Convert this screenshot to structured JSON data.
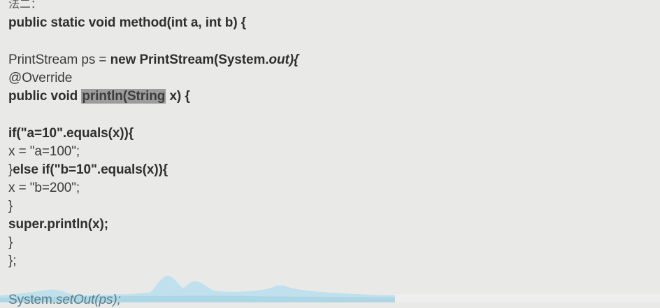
{
  "heading": "法二：",
  "lines": {
    "l1": "public static void method(int a, int b) {",
    "l2a": "PrintStream ps = ",
    "l2b": "new PrintStream(System.",
    "l2c": "out)",
    "l2d": "{",
    "l3": "@Override",
    "l4a": "public void ",
    "l4b": "println(String",
    "l4c": " x) {",
    "l5a": "if(\"a=10\".equals(x)){",
    "l6": "x = \"a=100\";",
    "l7a": "}",
    "l7b": "else if(\"b=10\".equals(x)){",
    "l8": "x = \"b=200\";",
    "l9": "}",
    "l10": "super.println(x);",
    "l11": "}",
    "l12": "};",
    "l13a": "System.",
    "l13b": "setOut(ps);"
  },
  "colors": {
    "background": "#e9eae8",
    "highlight": "#9c9c9c",
    "wave": "#bfe0ec"
  }
}
